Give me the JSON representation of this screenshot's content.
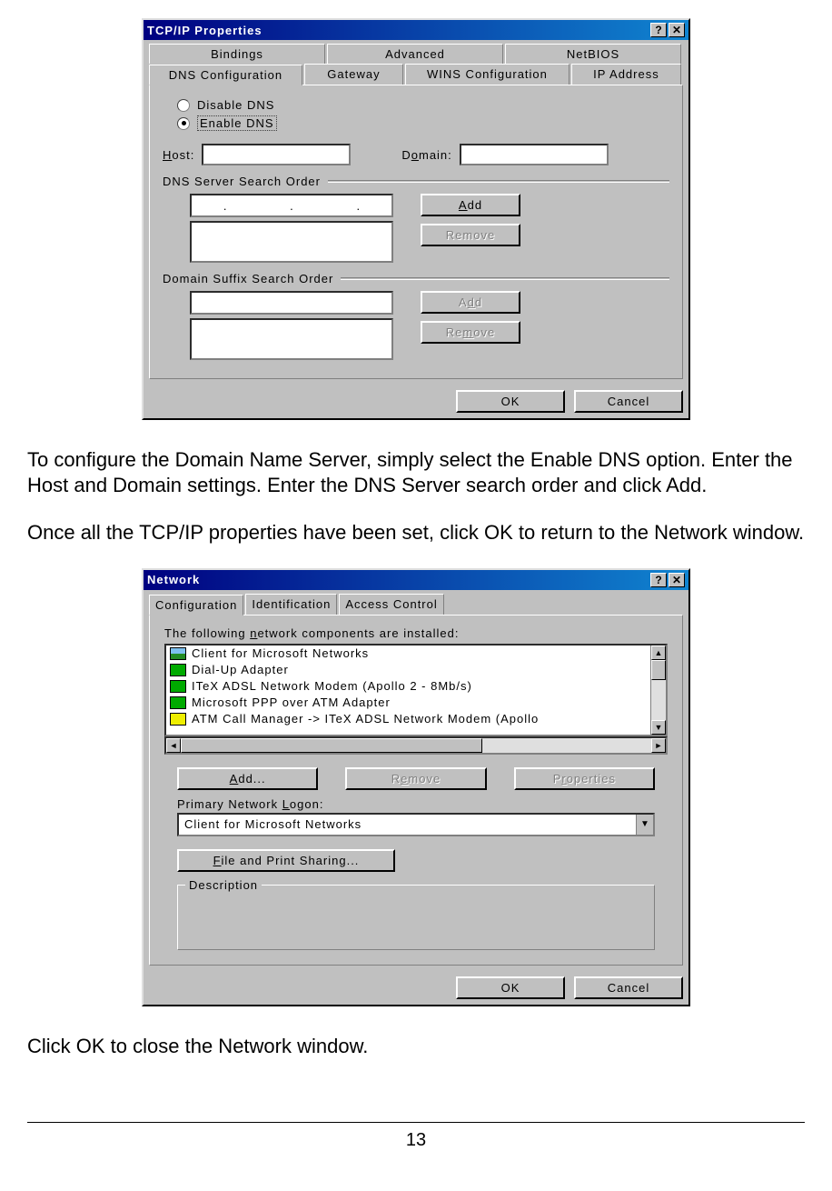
{
  "tcpip": {
    "title": "TCP/IP Properties",
    "tabs_row1": [
      "Bindings",
      "Advanced",
      "NetBIOS"
    ],
    "tabs_row2": [
      "DNS Configuration",
      "Gateway",
      "WINS Configuration",
      "IP Address"
    ],
    "radio_disable": "Disable DNS",
    "radio_enable": "Enable DNS",
    "host_label": "Host:",
    "domain_label": "Domain:",
    "dns_group": "DNS Server Search Order",
    "domain_suffix_group": "Domain Suffix Search Order",
    "add": "Add",
    "remove": "Remove",
    "ok": "OK",
    "cancel": "Cancel"
  },
  "text": {
    "p1": "To configure the Domain Name Server, simply select the Enable DNS option. Enter the Host and Domain settings.  Enter the DNS Server search order and click Add.",
    "p2": "Once all the TCP/IP properties have been set, click OK to return to the Network window.",
    "p3": "Click OK to close the Network window."
  },
  "network": {
    "title": "Network",
    "tabs": [
      "Configuration",
      "Identification",
      "Access Control"
    ],
    "heading": "The following network components are installed:",
    "items": [
      "Client for Microsoft Networks",
      "Dial-Up Adapter",
      "ITeX ADSL Network Modem (Apollo 2 - 8Mb/s)",
      "Microsoft PPP over ATM Adapter",
      "ATM Call Manager -> ITeX ADSL Network Modem (Apollo"
    ],
    "add": "Add...",
    "remove": "Remove",
    "properties": "Properties",
    "logon_label": "Primary Network Logon:",
    "logon_value": "Client for Microsoft Networks",
    "file_print": "File and Print Sharing...",
    "description": "Description",
    "ok": "OK",
    "cancel": "Cancel"
  },
  "page_number": "13"
}
